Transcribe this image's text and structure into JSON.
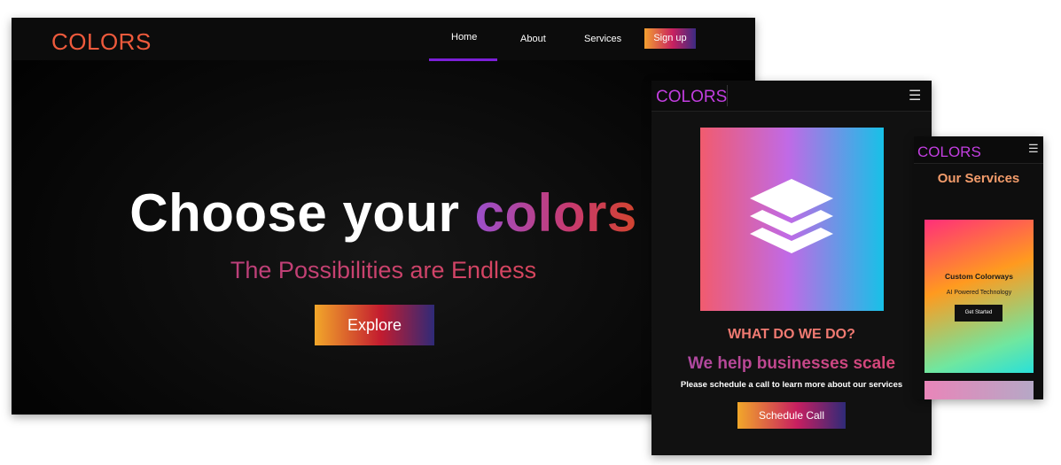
{
  "desktop": {
    "logo": "COLORS",
    "nav": {
      "home": "Home",
      "about": "About",
      "services": "Services",
      "signup": "Sign up"
    },
    "hero": {
      "title_white": "Choose your ",
      "title_accent": "colors",
      "tagline": "The Possibilities are Endless",
      "button": "Explore"
    }
  },
  "tablet": {
    "logo": "COLORS",
    "what": "WHAT DO WE DO?",
    "headline": "We help businesses scale",
    "subtext": "Please schedule a call to learn more about our services",
    "button": "Schedule Call",
    "icons": {
      "menu": "hamburger-icon",
      "hero": "layers-icon"
    }
  },
  "phone": {
    "logo": "COLORS",
    "title": "Our Services",
    "card": {
      "title": "Custom Colorways",
      "subtitle": "AI Powered Technology",
      "button": "Get Started"
    },
    "icons": {
      "menu": "hamburger-icon"
    }
  },
  "colors": {
    "accent_orange": "#ee5a3c",
    "accent_purple": "#c23ee0",
    "nav_underline": "#7c1fd8"
  }
}
